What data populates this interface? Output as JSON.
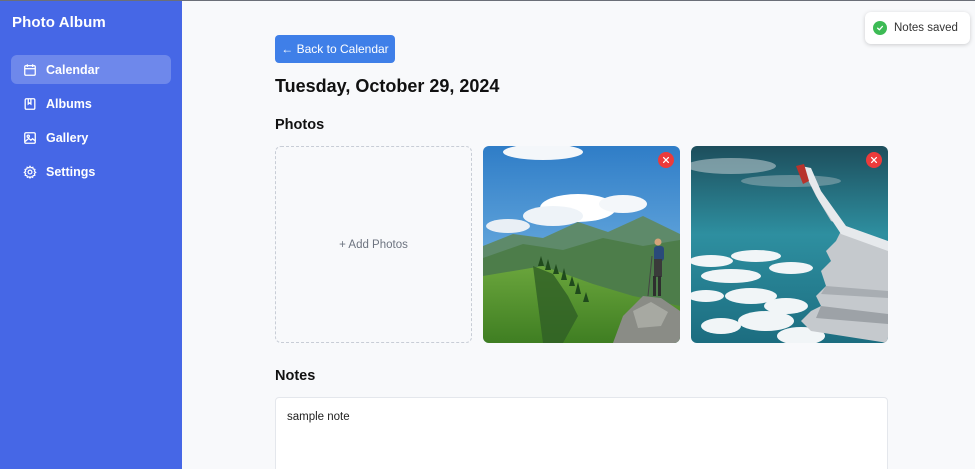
{
  "app": {
    "title": "Photo Album"
  },
  "sidebar": {
    "items": [
      {
        "label": "Calendar",
        "icon": "calendar-icon",
        "active": true
      },
      {
        "label": "Albums",
        "icon": "album-icon",
        "active": false
      },
      {
        "label": "Gallery",
        "icon": "image-icon",
        "active": false
      },
      {
        "label": "Settings",
        "icon": "gear-icon",
        "active": false
      }
    ]
  },
  "main": {
    "back_label": "← Back to Calendar",
    "date_title": "Tuesday, October 29, 2024",
    "photos_heading": "Photos",
    "add_photos_label": "+ Add Photos",
    "photos": [
      {
        "subject": "hiker on mountain ridge"
      },
      {
        "subject": "airplane wing above clouds"
      }
    ],
    "notes_heading": "Notes",
    "notes_value": "sample note"
  },
  "toast": {
    "text": "Notes saved",
    "icon": "check-circle-icon"
  },
  "colors": {
    "sidebar": "#4667e6",
    "primary_button": "#3f7fe8",
    "remove": "#ec3b3b",
    "success": "#3dbb55"
  }
}
